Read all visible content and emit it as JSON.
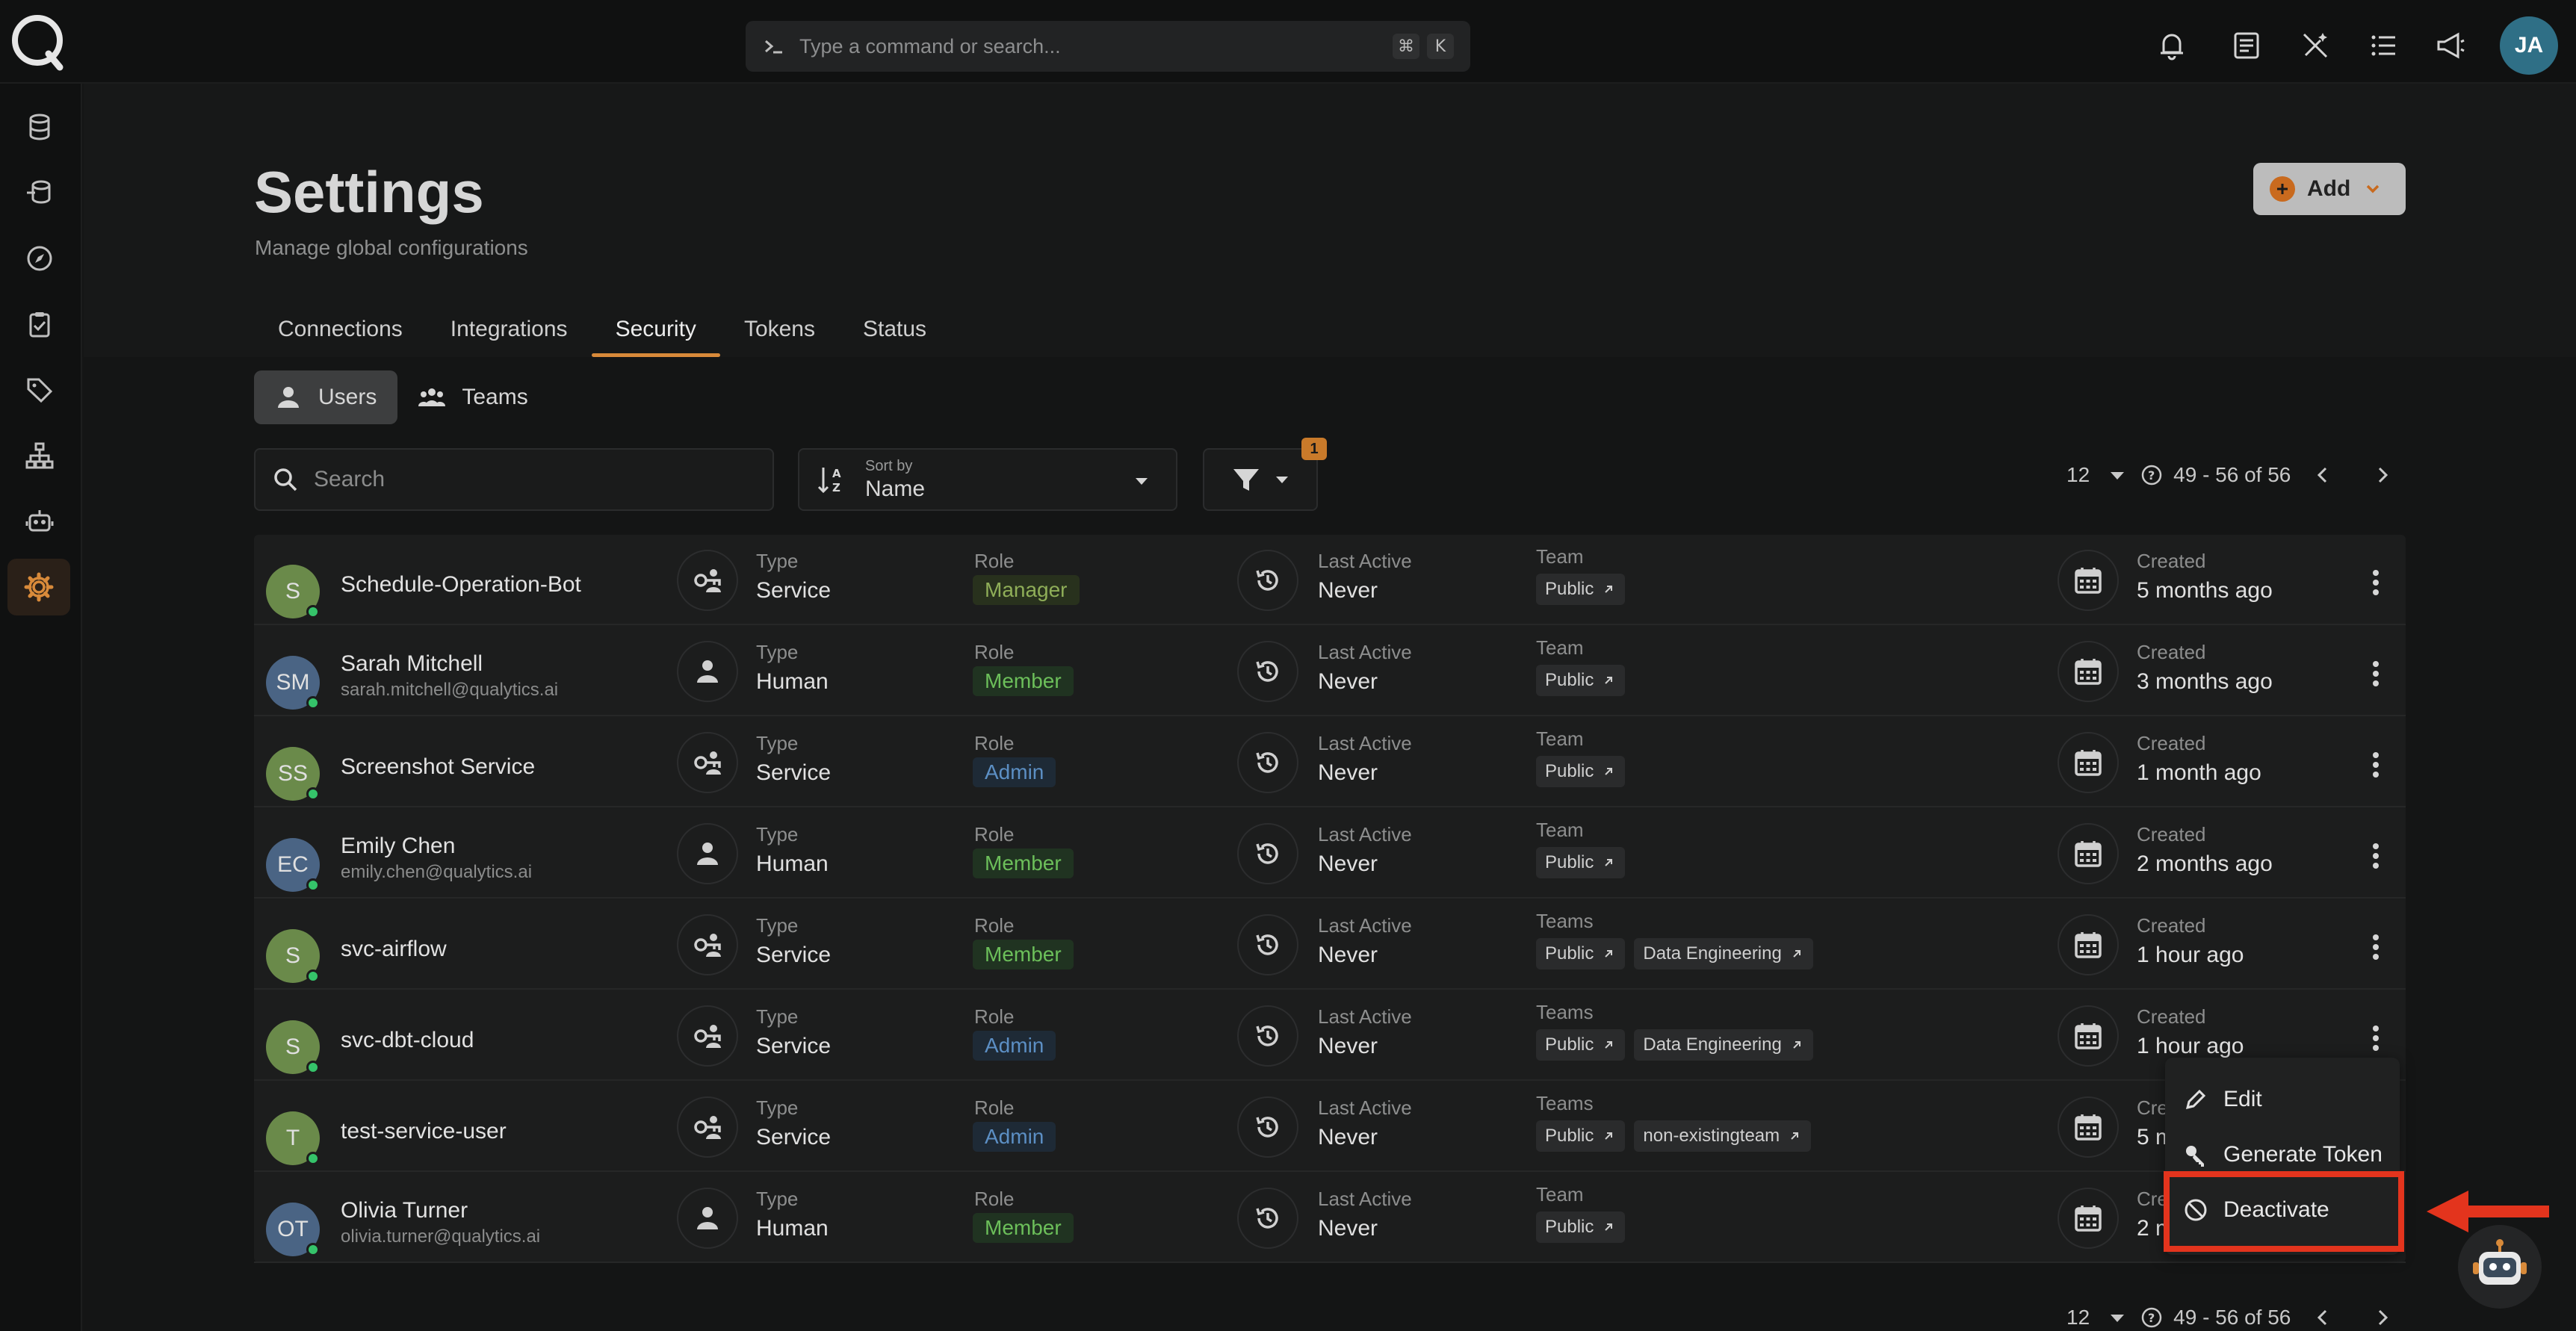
{
  "command_bar": {
    "placeholder": "Type a command or search...",
    "shortcut_keys": [
      "⌘",
      "K"
    ]
  },
  "user": {
    "initials": "JA"
  },
  "header": {
    "title": "Settings",
    "subtitle": "Manage global configurations",
    "add_label": "Add"
  },
  "tabs": [
    "Connections",
    "Integrations",
    "Security",
    "Tokens",
    "Status"
  ],
  "active_tab": "Security",
  "subtabs": [
    {
      "label": "Users"
    },
    {
      "label": "Teams"
    }
  ],
  "toolbar": {
    "search_placeholder": "Search",
    "sort_label": "Sort by",
    "sort_value": "Name",
    "filter_count": "1"
  },
  "pagination": {
    "page_size": "12",
    "range": "49 - 56 of 56"
  },
  "column_labels": {
    "type": "Type",
    "role": "Role",
    "last_active": "Last Active",
    "created": "Created"
  },
  "users": [
    {
      "initials": "S",
      "name": "Schedule-Operation-Bot",
      "email": "",
      "type": "Service",
      "role": "Manager",
      "last_active": "Never",
      "team_label": "Team",
      "teams": [
        "Public"
      ],
      "created": "5 months ago",
      "avatar_color": "#6a8a4a"
    },
    {
      "initials": "SM",
      "name": "Sarah Mitchell",
      "email": "sarah.mitchell@qualytics.ai",
      "type": "Human",
      "role": "Member",
      "last_active": "Never",
      "team_label": "Team",
      "teams": [
        "Public"
      ],
      "created": "3 months ago",
      "avatar_color": "#4a6484"
    },
    {
      "initials": "SS",
      "name": "Screenshot Service",
      "email": "",
      "type": "Service",
      "role": "Admin",
      "last_active": "Never",
      "team_label": "Team",
      "teams": [
        "Public"
      ],
      "created": "1 month ago",
      "avatar_color": "#6a8a4a"
    },
    {
      "initials": "EC",
      "name": "Emily Chen",
      "email": "emily.chen@qualytics.ai",
      "type": "Human",
      "role": "Member",
      "last_active": "Never",
      "team_label": "Team",
      "teams": [
        "Public"
      ],
      "created": "2 months ago",
      "avatar_color": "#4a6484"
    },
    {
      "initials": "S",
      "name": "svc-airflow",
      "email": "",
      "type": "Service",
      "role": "Member",
      "last_active": "Never",
      "team_label": "Teams",
      "teams": [
        "Public",
        "Data Engineering"
      ],
      "created": "1 hour ago",
      "avatar_color": "#6a8a4a"
    },
    {
      "initials": "S",
      "name": "svc-dbt-cloud",
      "email": "",
      "type": "Service",
      "role": "Admin",
      "last_active": "Never",
      "team_label": "Teams",
      "teams": [
        "Public",
        "Data Engineering"
      ],
      "created": "1 hour ago",
      "avatar_color": "#6a8a4a"
    },
    {
      "initials": "T",
      "name": "test-service-user",
      "email": "",
      "type": "Service",
      "role": "Admin",
      "last_active": "Never",
      "team_label": "Teams",
      "teams": [
        "Public",
        "non-existingteam"
      ],
      "created": "5 m",
      "avatar_color": "#6a8a4a"
    },
    {
      "initials": "OT",
      "name": "Olivia Turner",
      "email": "olivia.turner@qualytics.ai",
      "type": "Human",
      "role": "Member",
      "last_active": "Never",
      "team_label": "Team",
      "teams": [
        "Public"
      ],
      "created": "2 m",
      "avatar_color": "#4a6484"
    }
  ],
  "context_menu": {
    "items": [
      "Edit",
      "Generate Token",
      "Deactivate"
    ]
  },
  "colors": {
    "accent": "#d88a3a",
    "highlight": "#e3341d",
    "online": "#35c36a"
  }
}
